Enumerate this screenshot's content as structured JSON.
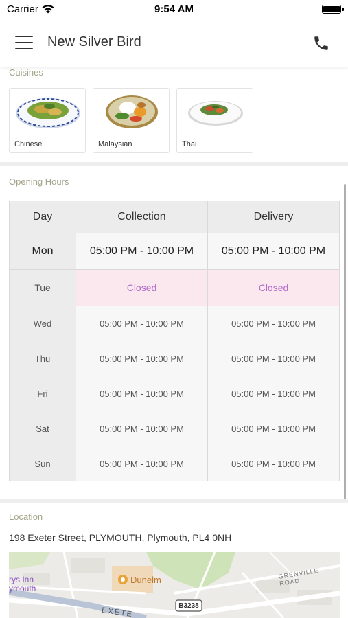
{
  "status_bar": {
    "carrier": "Carrier",
    "time": "9:54 AM"
  },
  "header": {
    "title": "New Silver Bird",
    "icons": [
      "menu-icon",
      "phone-icon"
    ]
  },
  "cuisines": {
    "label": "Cuisines",
    "items": [
      {
        "name": "Chinese"
      },
      {
        "name": "Malaysian"
      },
      {
        "name": "Thai"
      }
    ]
  },
  "opening_hours": {
    "label": "Opening Hours",
    "columns": [
      "Day",
      "Collection",
      "Delivery"
    ],
    "rows": [
      {
        "day": "Mon",
        "collection": "05:00 PM - 10:00 PM",
        "delivery": "05:00 PM - 10:00 PM",
        "highlight": "today"
      },
      {
        "day": "Tue",
        "collection": "Closed",
        "delivery": "Closed",
        "highlight": "closed"
      },
      {
        "day": "Wed",
        "collection": "05:00 PM - 10:00 PM",
        "delivery": "05:00 PM - 10:00 PM"
      },
      {
        "day": "Thu",
        "collection": "05:00 PM - 10:00 PM",
        "delivery": "05:00 PM - 10:00 PM"
      },
      {
        "day": "Fri",
        "collection": "05:00 PM - 10:00 PM",
        "delivery": "05:00 PM - 10:00 PM"
      },
      {
        "day": "Sat",
        "collection": "05:00 PM - 10:00 PM",
        "delivery": "05:00 PM - 10:00 PM"
      },
      {
        "day": "Sun",
        "collection": "05:00 PM - 10:00 PM",
        "delivery": "05:00 PM - 10:00 PM"
      }
    ]
  },
  "location": {
    "label": "Location",
    "address": "198 Exeter Street, PLYMOUTH, Plymouth, PL4 0NH",
    "map": {
      "poi_dunelm": "Dunelm",
      "poi_inn_line1": "rys Inn",
      "poi_inn_line2": "ymouth",
      "road_label": "GRENVILLE ROAD",
      "street_label": "EXETE",
      "route_badge": "B3238"
    }
  },
  "colors": {
    "section_label": "#a3a38a",
    "closed_bg": "#fbe8ee",
    "closed_text": "#b06ac8",
    "header_cell_bg": "#ececec",
    "map_poi": "#e8a33a"
  }
}
